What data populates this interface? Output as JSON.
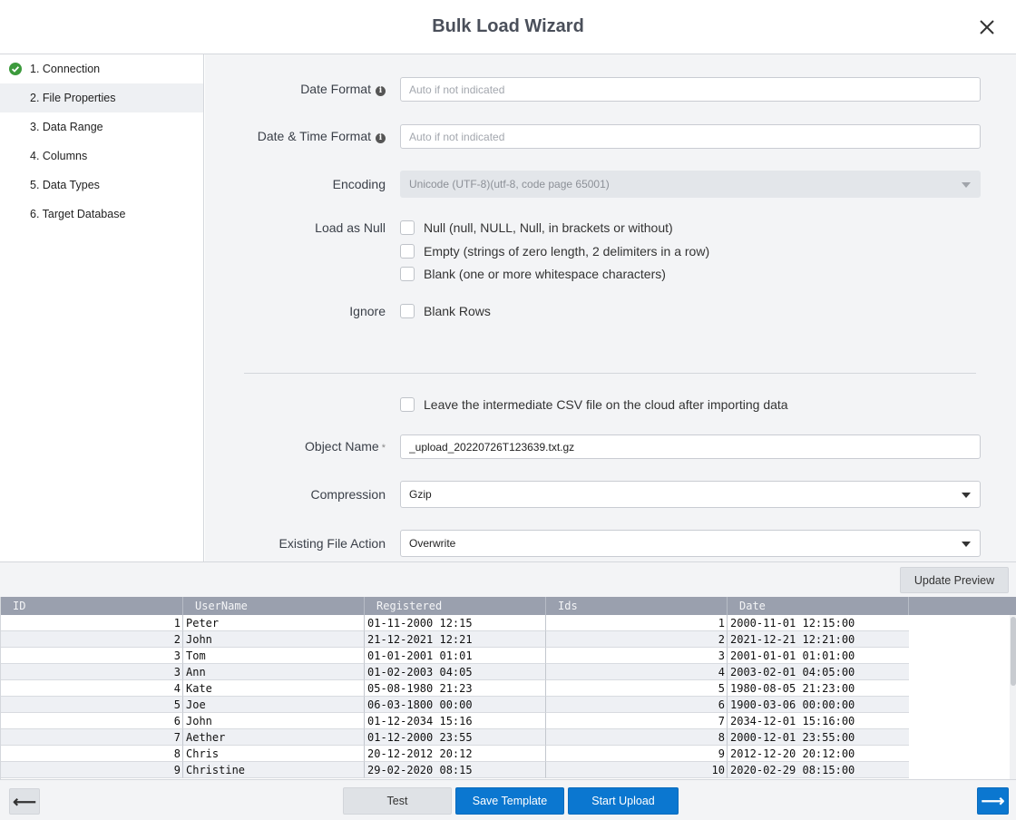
{
  "window": {
    "title": "Bulk Load Wizard"
  },
  "steps": [
    {
      "label": "1. Connection",
      "completed": true
    },
    {
      "label": "2. File Properties",
      "active": true
    },
    {
      "label": "3. Data Range"
    },
    {
      "label": "4. Columns"
    },
    {
      "label": "5. Data Types"
    },
    {
      "label": "6. Target Database"
    }
  ],
  "form": {
    "date_format": {
      "label": "Date Format",
      "placeholder": "Auto if not indicated"
    },
    "datetime_format": {
      "label": "Date & Time Format",
      "placeholder": "Auto if not indicated"
    },
    "encoding": {
      "label": "Encoding",
      "value": "Unicode (UTF-8)(utf-8, code page 65001)"
    },
    "load_as_null": {
      "label": "Load as Null",
      "options": [
        "Null (null, NULL, Null, in brackets or without)",
        "Empty (strings of zero length, 2 delimiters in a row)",
        "Blank (one or more whitespace characters)"
      ]
    },
    "ignore": {
      "label": "Ignore",
      "options": [
        "Blank Rows"
      ]
    },
    "leave_csv": {
      "label": "Leave the intermediate CSV file on the cloud after importing data"
    },
    "object_name": {
      "label": "Object Name",
      "required_mark": "*",
      "value": "_upload_20220726T123639.txt.gz"
    },
    "compression": {
      "label": "Compression",
      "value": "Gzip"
    },
    "existing_file_action": {
      "label": "Existing File Action",
      "value": "Overwrite"
    }
  },
  "toolbar": {
    "update_preview_label": "Update Preview"
  },
  "grid": {
    "columns": [
      "ID",
      "UserName",
      "Registered",
      "Ids",
      "Date"
    ],
    "rows": [
      [
        "1",
        "Peter",
        "01-11-2000 12:15",
        "1",
        "2000-11-01 12:15:00"
      ],
      [
        "2",
        "John",
        "21-12-2021 12:21",
        "2",
        "2021-12-21 12:21:00"
      ],
      [
        "3",
        "Tom",
        "01-01-2001 01:01",
        "3",
        "2001-01-01 01:01:00"
      ],
      [
        "3",
        "Ann",
        "01-02-2003 04:05",
        "4",
        "2003-02-01 04:05:00"
      ],
      [
        "4",
        "Kate",
        "05-08-1980 21:23",
        "5",
        "1980-08-05 21:23:00"
      ],
      [
        "5",
        "Joe",
        "06-03-1800 00:00",
        "6",
        "1900-03-06 00:00:00"
      ],
      [
        "6",
        "John",
        "01-12-2034 15:16",
        "7",
        "2034-12-01 15:16:00"
      ],
      [
        "7",
        "Aether",
        "01-12-2000 23:55",
        "8",
        "2000-12-01 23:55:00"
      ],
      [
        "8",
        "Chris",
        "20-12-2012 20:12",
        "9",
        "2012-12-20 20:12:00"
      ],
      [
        "9",
        "Christine",
        "29-02-2020 08:15",
        "10",
        "2020-02-29 08:15:00"
      ]
    ]
  },
  "footer": {
    "back_label": "⟵",
    "test_label": "Test",
    "save_template_label": "Save Template",
    "start_upload_label": "Start Upload",
    "next_label": "⟶"
  },
  "colors": {
    "accent": "#0b77d0",
    "success": "#3c9a3c",
    "grid_header": "#9aa0ae"
  }
}
